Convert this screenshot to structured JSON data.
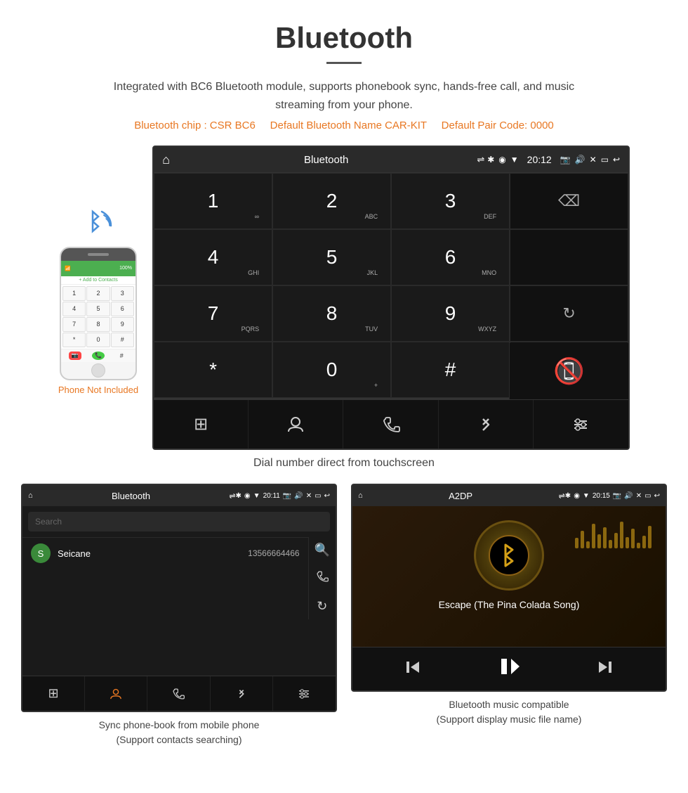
{
  "page": {
    "title": "Bluetooth",
    "divider": true,
    "description": "Integrated with BC6 Bluetooth module, supports phonebook sync, hands-free call, and music streaming from your phone.",
    "spec_line": "(Bluetooth chip : CSR BC6    Default Bluetooth Name CAR-KIT    Default Pair Code: 0000)",
    "spec_parts": {
      "chip": "Bluetooth chip : CSR BC6",
      "name": "Default Bluetooth Name CAR-KIT",
      "pair": "Default Pair Code: 0000"
    }
  },
  "main_screen": {
    "status_bar": {
      "home_icon": "⌂",
      "title": "Bluetooth",
      "usb_icon": "⇌",
      "bt_icon": "✱",
      "location_icon": "◉",
      "signal_icon": "▼",
      "time": "20:12",
      "camera_icon": "📷",
      "volume_icon": "🔊",
      "close_icon": "✕",
      "window_icon": "▭",
      "back_icon": "↩"
    },
    "dialpad": [
      {
        "num": "1",
        "sub": "∞",
        "row": 0,
        "col": 0
      },
      {
        "num": "2",
        "sub": "ABC",
        "row": 0,
        "col": 1
      },
      {
        "num": "3",
        "sub": "DEF",
        "row": 0,
        "col": 2
      },
      {
        "num": "",
        "sub": "",
        "row": 0,
        "col": 3,
        "action": "delete"
      },
      {
        "num": "4",
        "sub": "GHI",
        "row": 1,
        "col": 0
      },
      {
        "num": "5",
        "sub": "JKL",
        "row": 1,
        "col": 1
      },
      {
        "num": "6",
        "sub": "MNO",
        "row": 1,
        "col": 2
      },
      {
        "num": "",
        "sub": "",
        "row": 1,
        "col": 3,
        "action": "empty"
      },
      {
        "num": "7",
        "sub": "PQRS",
        "row": 2,
        "col": 0
      },
      {
        "num": "8",
        "sub": "TUV",
        "row": 2,
        "col": 1
      },
      {
        "num": "9",
        "sub": "WXYZ",
        "row": 2,
        "col": 2
      },
      {
        "num": "",
        "sub": "",
        "row": 2,
        "col": 3,
        "action": "refresh"
      },
      {
        "num": "*",
        "sub": "",
        "row": 3,
        "col": 0
      },
      {
        "num": "0",
        "sub": "+",
        "row": 3,
        "col": 1
      },
      {
        "num": "#",
        "sub": "",
        "row": 3,
        "col": 2
      },
      {
        "num": "",
        "sub": "",
        "row": 3,
        "col": 3,
        "action": "call"
      },
      {
        "num": "",
        "sub": "",
        "row": 3,
        "col": 4,
        "action": "end"
      }
    ],
    "bottom_bar": [
      "⊞",
      "👤",
      "📞",
      "✱",
      "✎"
    ]
  },
  "caption_main": "Dial number direct from touchscreen",
  "phone_label": "Phone Not Included",
  "contacts_screen": {
    "status_bar": {
      "title": "Bluetooth",
      "usb_icon": "⇌",
      "bt_icon": "✱",
      "location_icon": "◉",
      "signal_icon": "▼",
      "time": "20:11"
    },
    "search_placeholder": "Search",
    "contact": {
      "initial": "S",
      "name": "Seicane",
      "number": "13566664466"
    },
    "right_icons": [
      "🔍",
      "📞",
      "↺"
    ],
    "bottom_bar": [
      "⊞",
      "👤",
      "📞",
      "✱",
      "✎"
    ]
  },
  "music_screen": {
    "status_bar": {
      "title": "A2DP",
      "time": "20:15"
    },
    "song_title": "Escape (The Pina Colada Song)",
    "controls": [
      "⏮",
      "⏯",
      "⏭"
    ],
    "album_icon": "♪"
  },
  "caption_contacts": {
    "line1": "Sync phone-book from mobile phone",
    "line2": "(Support contacts searching)"
  },
  "caption_music": {
    "line1": "Bluetooth music compatible",
    "line2": "(Support display music file name)"
  }
}
